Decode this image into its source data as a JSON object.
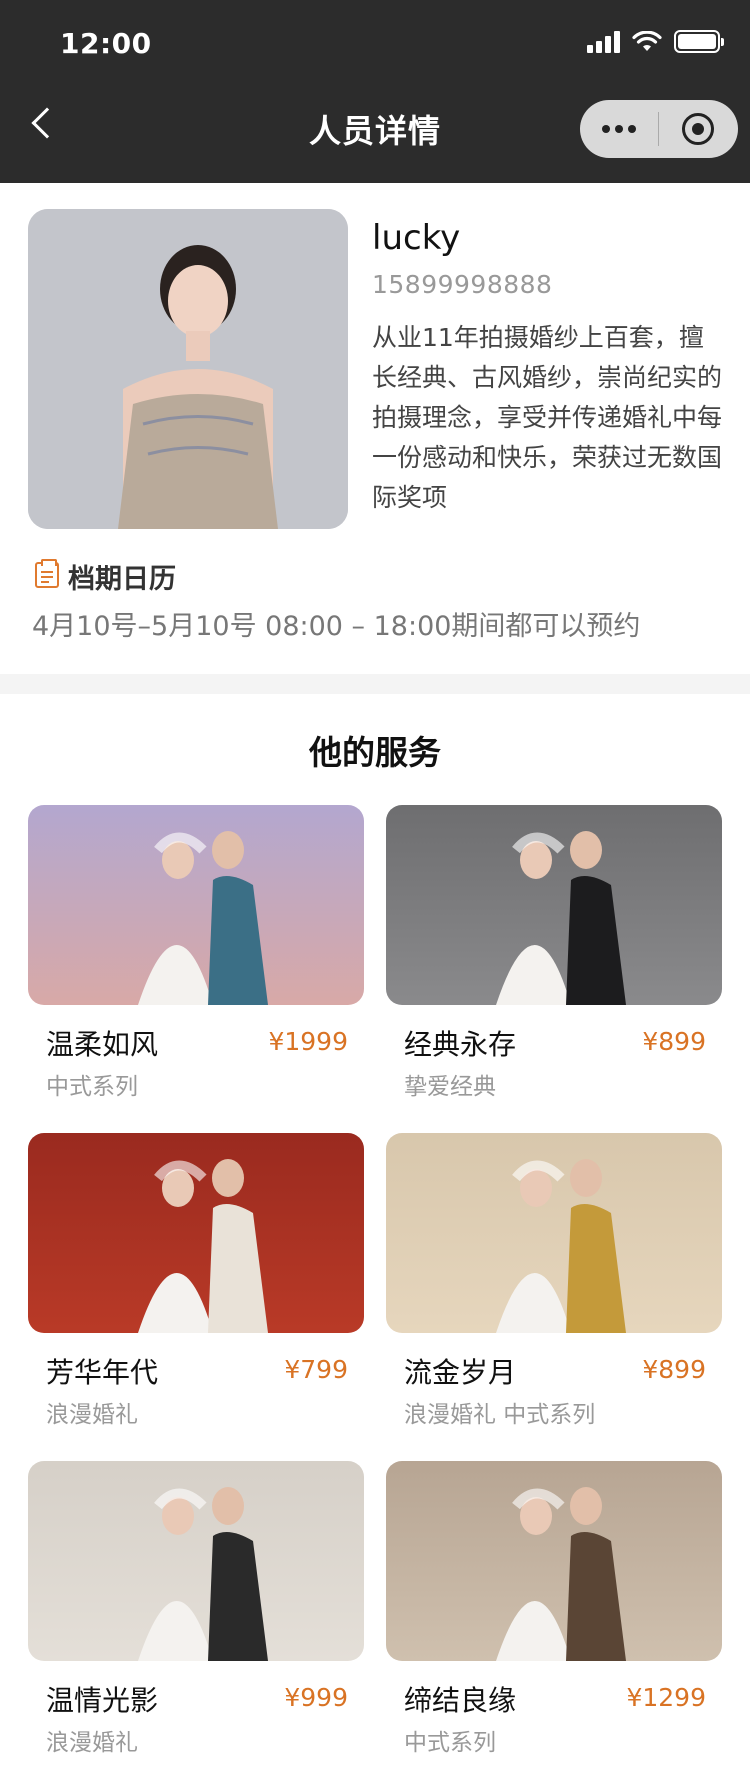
{
  "status_bar": {
    "time": "12:00"
  },
  "nav": {
    "title": "人员详情",
    "back_icon": "chevron-left-icon",
    "more_icon": "more-dots-icon",
    "close_icon": "target-icon"
  },
  "profile": {
    "name": "lucky",
    "phone": "15899998888",
    "bio": "从业11年拍摄婚纱上百套，擅长经典、古风婚纱，崇尚纪实的拍摄理念，享受并传递婚礼中每一份感动和快乐，荣获过无数国际奖项"
  },
  "schedule": {
    "title": "档期日历",
    "icon": "calendar-icon",
    "text": "4月10号–5月10号   08:00 – 18:00期间都可以预约"
  },
  "services": {
    "title": "他的服务",
    "items": [
      {
        "title": "温柔如风",
        "price": "¥1999",
        "tag": "中式系列",
        "palette": [
          "#b3a7cf",
          "#d8a9a7",
          "#3b6f86"
        ]
      },
      {
        "title": "经典永存",
        "price": "¥899",
        "tag": "挚爱经典",
        "palette": [
          "#6e6e70",
          "#8a8a8c",
          "#1c1c1e"
        ]
      },
      {
        "title": "芳华年代",
        "price": "¥799",
        "tag": "浪漫婚礼",
        "palette": [
          "#9a2a1f",
          "#b93a27",
          "#e9e2d8"
        ]
      },
      {
        "title": "流金岁月",
        "price": "¥899",
        "tag": "浪漫婚礼  中式系列",
        "palette": [
          "#d8c7ac",
          "#e6d6bd",
          "#c49a3a"
        ]
      },
      {
        "title": "温情光影",
        "price": "¥999",
        "tag": "浪漫婚礼",
        "palette": [
          "#d6d0c8",
          "#e4dfd8",
          "#2a2a2a"
        ]
      },
      {
        "title": "缔结良缘",
        "price": "¥1299",
        "tag": "中式系列",
        "palette": [
          "#b7a593",
          "#cfc0ae",
          "#5a4535"
        ]
      }
    ]
  }
}
